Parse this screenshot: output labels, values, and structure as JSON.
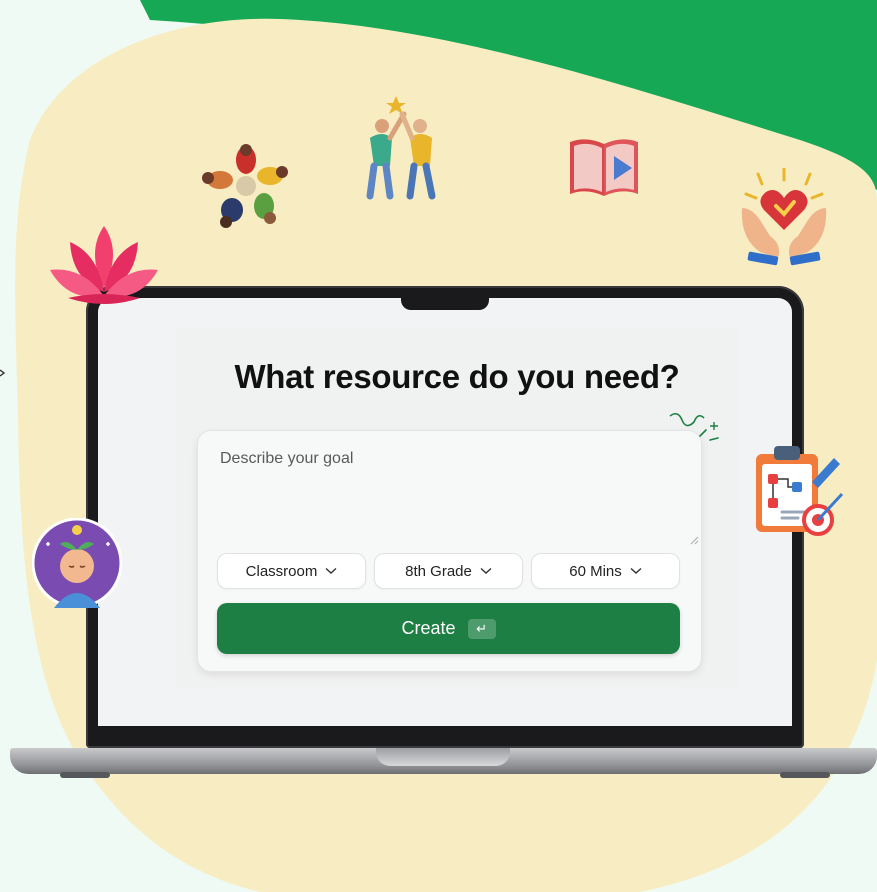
{
  "page": {
    "title": "What resource do you need?"
  },
  "form": {
    "goal_placeholder": "Describe your goal",
    "goal_value": "",
    "selects": [
      {
        "value": "Classroom"
      },
      {
        "value": "8th Grade"
      },
      {
        "value": "60 Mins"
      }
    ],
    "create_label": "Create",
    "enter_key_glyph": "↵"
  },
  "icons": {
    "teamwork": "teamwork-circle-icon",
    "high_five": "high-five-icon",
    "video_book": "video-book-icon",
    "heart_hands": "heart-hands-icon",
    "lotus": "lotus-icon",
    "mindful_avatar": "mindful-head-icon",
    "lesson_plan": "lesson-plan-clipboard-icon",
    "sparkle_doodle": "sparkle-doodle-icon"
  },
  "colors": {
    "accent_green": "#1d7f44",
    "blob_cream": "#f8edc2",
    "corner_green": "#16a855"
  }
}
